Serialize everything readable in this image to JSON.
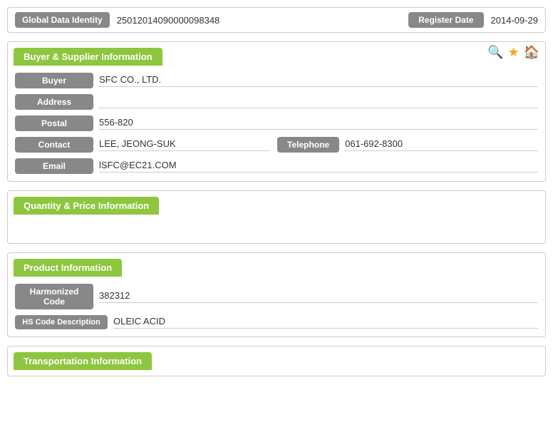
{
  "globalBar": {
    "label": "Global Data Identity",
    "value": "25012014090000098348",
    "regLabel": "Register Date",
    "regValue": "2014-09-29"
  },
  "buyerSupplier": {
    "sectionTitle": "Buyer & Supplier Information",
    "fields": {
      "buyerLabel": "Buyer",
      "buyerValue": "SFC CO., LTD.",
      "addressLabel": "Address",
      "addressValue": "",
      "postalLabel": "Postal",
      "postalValue": "556-820",
      "contactLabel": "Contact",
      "contactValue": "LEE, JEONG-SUK",
      "telephoneLabel": "Telephone",
      "telephoneValue": "061-692-8300",
      "emailLabel": "Email",
      "emailValue": "lSFC@EC21.COM"
    },
    "icons": {
      "search": "🔍",
      "star": "★",
      "home": "🏠"
    }
  },
  "quantityPrice": {
    "sectionTitle": "Quantity & Price Information"
  },
  "productInfo": {
    "sectionTitle": "Product Information",
    "fields": {
      "harmonizedCodeLabel": "Harmonized Code",
      "harmonizedCodeValue": "382312",
      "hsCodeDescLabel": "HS Code Description",
      "hsCodeDescValue": "OLEIC ACID"
    }
  },
  "transportation": {
    "sectionTitle": "Transportation Information"
  }
}
